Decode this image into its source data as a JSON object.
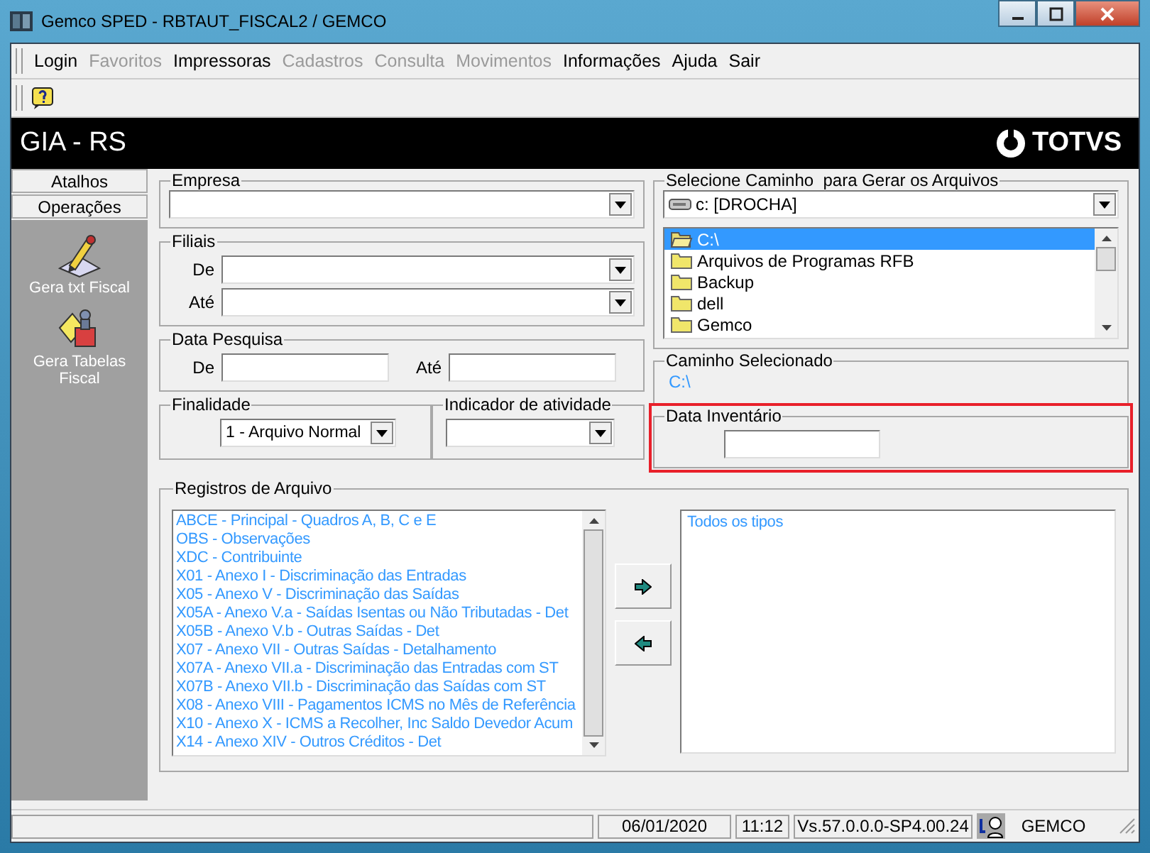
{
  "window": {
    "title": "Gemco SPED - RBTAUT_FISCAL2 / GEMCO"
  },
  "menu": [
    {
      "label": "Login",
      "disabled": false
    },
    {
      "label": "Favoritos",
      "disabled": true
    },
    {
      "label": "Impressoras",
      "disabled": false
    },
    {
      "label": "Cadastros",
      "disabled": true
    },
    {
      "label": "Consulta",
      "disabled": true
    },
    {
      "label": "Movimentos",
      "disabled": true
    },
    {
      "label": "Informações",
      "disabled": false
    },
    {
      "label": "Ajuda",
      "disabled": false
    },
    {
      "label": "Sair",
      "disabled": false
    }
  ],
  "header": {
    "title": "GIA - RS",
    "logo": "TOTVS"
  },
  "sidebar": {
    "tabs": [
      "Atalhos",
      "Operações"
    ],
    "items": [
      {
        "label": "Gera txt Fiscal",
        "kind": "pen"
      },
      {
        "label": "Gera Tabelas Fiscal",
        "kind": "tables"
      }
    ]
  },
  "empresa": {
    "label": "Empresa"
  },
  "filiais": {
    "label": "Filiais",
    "fields": [
      "De",
      "Até"
    ]
  },
  "data_pesquisa": {
    "label": "Data Pesquisa",
    "fields": [
      "De",
      "Até"
    ]
  },
  "finalidade": {
    "label": "Finalidade",
    "value": "1 - Arquivo Normal"
  },
  "indicador": {
    "label": "Indicador de atividade"
  },
  "caminho": {
    "label": "Selecione Caminho  para Gerar os Arquivos",
    "drive": "c: [DROCHA]",
    "folders": [
      {
        "name": "C:\\",
        "selected": true,
        "kind": "open"
      },
      {
        "name": "Arquivos de Programas RFB",
        "selected": false,
        "kind": "closed"
      },
      {
        "name": "Backup",
        "selected": false,
        "kind": "closed"
      },
      {
        "name": "dell",
        "selected": false,
        "kind": "closed"
      },
      {
        "name": "Gemco",
        "selected": false,
        "kind": "closed"
      }
    ]
  },
  "caminho_selecionado": {
    "label": "Caminho Selecionado",
    "value": "C:\\"
  },
  "data_inventario": {
    "label": "Data Inventário",
    "highlighted": true
  },
  "registros": {
    "label": "Registros de Arquivo",
    "available": [
      "ABCE - Principal - Quadros A, B, C e E",
      "OBS - Observações",
      "XDC - Contribuinte",
      "X01 - Anexo I - Discriminação das Entradas",
      "X05 - Anexo V - Discriminação das Saídas",
      "X05A - Anexo V.a - Saídas Isentas ou Não Tributadas - Det",
      "X05B - Anexo V.b - Outras Saídas - Det",
      "X07 - Anexo VII - Outras Saídas - Detalhamento",
      "X07A - Anexo VII.a - Discriminação das Entradas com ST",
      "X07B - Anexo VII.b - Discriminação das Saídas com ST",
      "X08 - Anexo VIII - Pagamentos ICMS no Mês de Referência",
      "X10 - Anexo X - ICMS a Recolher, Inc Saldo Devedor Acum",
      "X14 - Anexo XIV - Outros Créditos - Det"
    ],
    "chosen": [
      "Todos os tipos"
    ]
  },
  "status_bar": {
    "date": "06/01/2020",
    "time": "11:12",
    "version": "Vs.57.0.0.0-SP4.00.24",
    "user": "GEMCO"
  }
}
